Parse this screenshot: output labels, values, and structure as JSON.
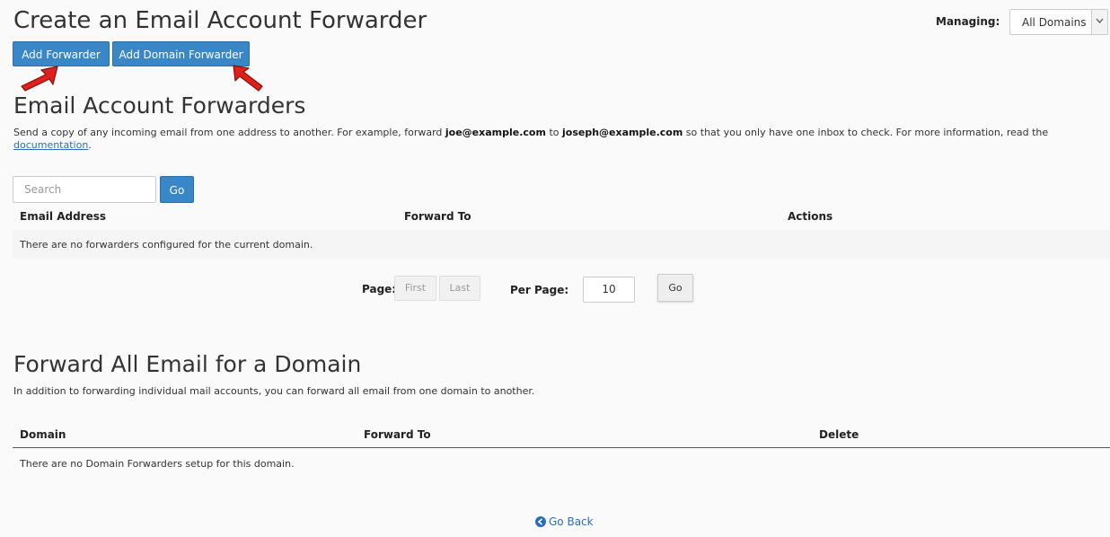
{
  "header": {
    "title": "Create an Email Account Forwarder",
    "managing_label": "Managing:",
    "managing_value": "All Domains",
    "add_forwarder": "Add Forwarder",
    "add_domain_forwarder": "Add Domain Forwarder"
  },
  "account_section": {
    "title": "Email Account Forwarders",
    "desc_part1": "Send a copy of any incoming email from one address to another. For example, forward ",
    "desc_email1": "joe@example.com",
    "desc_part2": " to ",
    "desc_email2": "joseph@example.com",
    "desc_part3": " so that you only have one inbox to check. For more information, read the",
    "desc_link": "documentation",
    "desc_end": ".",
    "search_placeholder": "Search",
    "search_go": "Go",
    "columns": [
      "Email Address",
      "Forward To",
      "Actions"
    ],
    "empty_message": "There are no forwarders configured for the current domain."
  },
  "pagination": {
    "page_label": "Page:",
    "first": "First",
    "last": "Last",
    "per_page_label": "Per Page:",
    "per_page_value": "10",
    "go": "Go"
  },
  "domain_section": {
    "title": "Forward All Email for a Domain",
    "desc": "In addition to forwarding individual mail accounts, you can forward all email from one domain to another.",
    "columns": [
      "Domain",
      "Forward To",
      "Delete"
    ],
    "empty_message": "There are no Domain Forwarders setup for this domain."
  },
  "footer": {
    "go_back": "Go Back"
  },
  "colors": {
    "primary_button": "#3a87c8",
    "link": "#2a6ebb",
    "annotation_arrow": "#e0201b"
  },
  "icons": {
    "select_caret": "chevron-down-icon",
    "go_back": "circle-arrow-left-icon",
    "annotation": "red-arrow-icon"
  }
}
